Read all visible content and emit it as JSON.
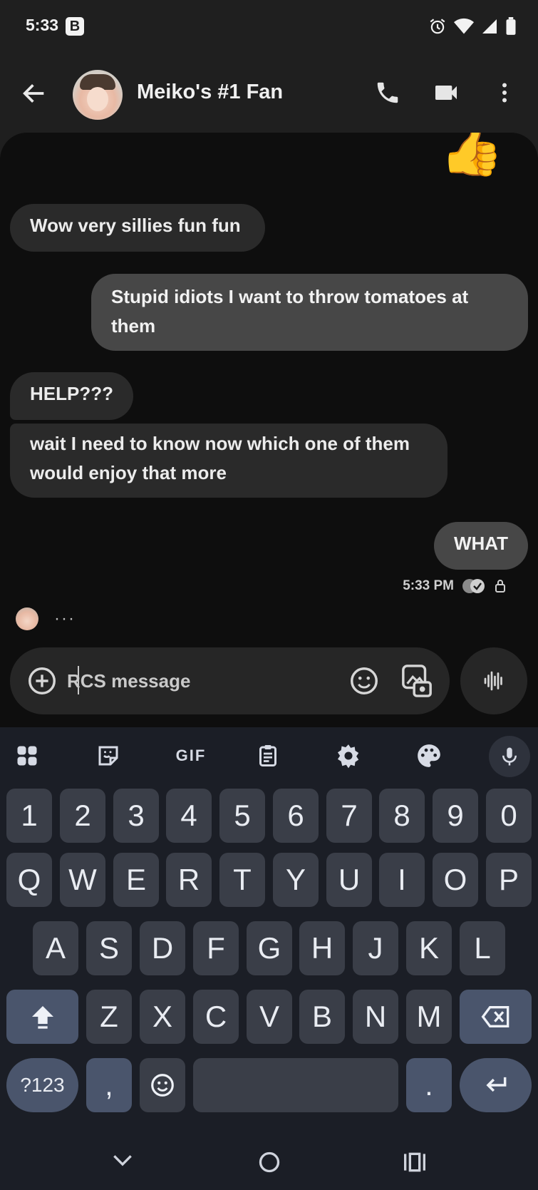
{
  "status_bar": {
    "time": "5:33",
    "badge": "B",
    "icons": [
      "alarm-icon",
      "wifi-icon",
      "signal-icon",
      "battery-icon"
    ]
  },
  "app_bar": {
    "contact_name": "Meiko's #1 Fan",
    "actions": [
      "phone-icon",
      "video-call-icon",
      "more-vert-icon"
    ]
  },
  "conversation": {
    "reaction_emoji": "👍",
    "messages": [
      {
        "direction": "incoming",
        "text": "Wow very sillies fun fun"
      },
      {
        "direction": "outgoing",
        "text": "Stupid idiots I want to throw tomatoes at them"
      },
      {
        "direction": "incoming",
        "text": "HELP???"
      },
      {
        "direction": "incoming",
        "text": "wait I need to know now which one of them would enjoy that more"
      },
      {
        "direction": "outgoing",
        "text": "WHAT"
      }
    ],
    "last_timestamp": "5:33 PM",
    "typing_indicator": "···"
  },
  "composer": {
    "placeholder": "RCS message",
    "value": ""
  },
  "keyboard": {
    "toolbar": [
      "apps-grid-icon",
      "sticker-icon",
      "gif-icon",
      "clipboard-icon",
      "settings-icon",
      "palette-icon",
      "mic-icon"
    ],
    "gif_label": "GIF",
    "row_numbers": [
      "1",
      "2",
      "3",
      "4",
      "5",
      "6",
      "7",
      "8",
      "9",
      "0"
    ],
    "row_top": [
      "Q",
      "W",
      "E",
      "R",
      "T",
      "Y",
      "U",
      "I",
      "O",
      "P"
    ],
    "row_mid": [
      "A",
      "S",
      "D",
      "F",
      "G",
      "H",
      "J",
      "K",
      "L"
    ],
    "row_bottom": [
      "Z",
      "X",
      "C",
      "V",
      "B",
      "N",
      "M"
    ],
    "symbols_label": "?123",
    "comma": ",",
    "period": "."
  },
  "colors": {
    "chat_bg": "#0e0e0e",
    "incoming_bubble": "#2a2a2a",
    "outgoing_bubble": "#474747",
    "keyboard_bg": "#1b1e26",
    "key_bg": "#3a3e48",
    "mod_key_bg": "#4a556c"
  }
}
